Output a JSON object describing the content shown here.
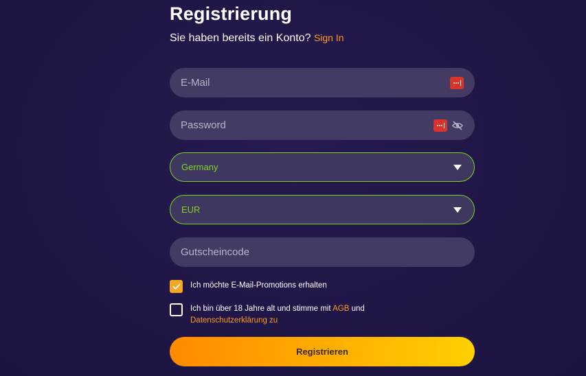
{
  "header": {
    "title": "Registrierung",
    "subtitle": "Sie haben bereits ein Konto?",
    "signin_link": "Sign In"
  },
  "form": {
    "email": {
      "placeholder": "E-Mail",
      "icon": "password-manager-icon"
    },
    "password": {
      "placeholder": "Password",
      "icons": [
        "password-manager-icon",
        "eye-slash-icon"
      ]
    },
    "country": {
      "value": "Germany",
      "icon": "caret-down-icon"
    },
    "currency": {
      "value": "EUR",
      "icon": "caret-down-icon"
    },
    "promo": {
      "placeholder": "Gutscheincode"
    },
    "promotions_checkbox": {
      "label": "Ich möchte E-Mail-Promotions erhalten",
      "checked": true
    },
    "terms_checkbox": {
      "label_prefix": "Ich bin über 18 Jahre alt und stimme mit",
      "agb_link": "AGB",
      "label_and": "und",
      "privacy_link": "Datenschutzerklärung zu",
      "checked": false
    },
    "submit_label": "Registrieren"
  },
  "colors": {
    "background": "#1f1646",
    "field": "#433b63",
    "accent_orange": "#ff9a1f",
    "select_border": "#7ed321",
    "checkbox_checked": "#f5a623"
  }
}
